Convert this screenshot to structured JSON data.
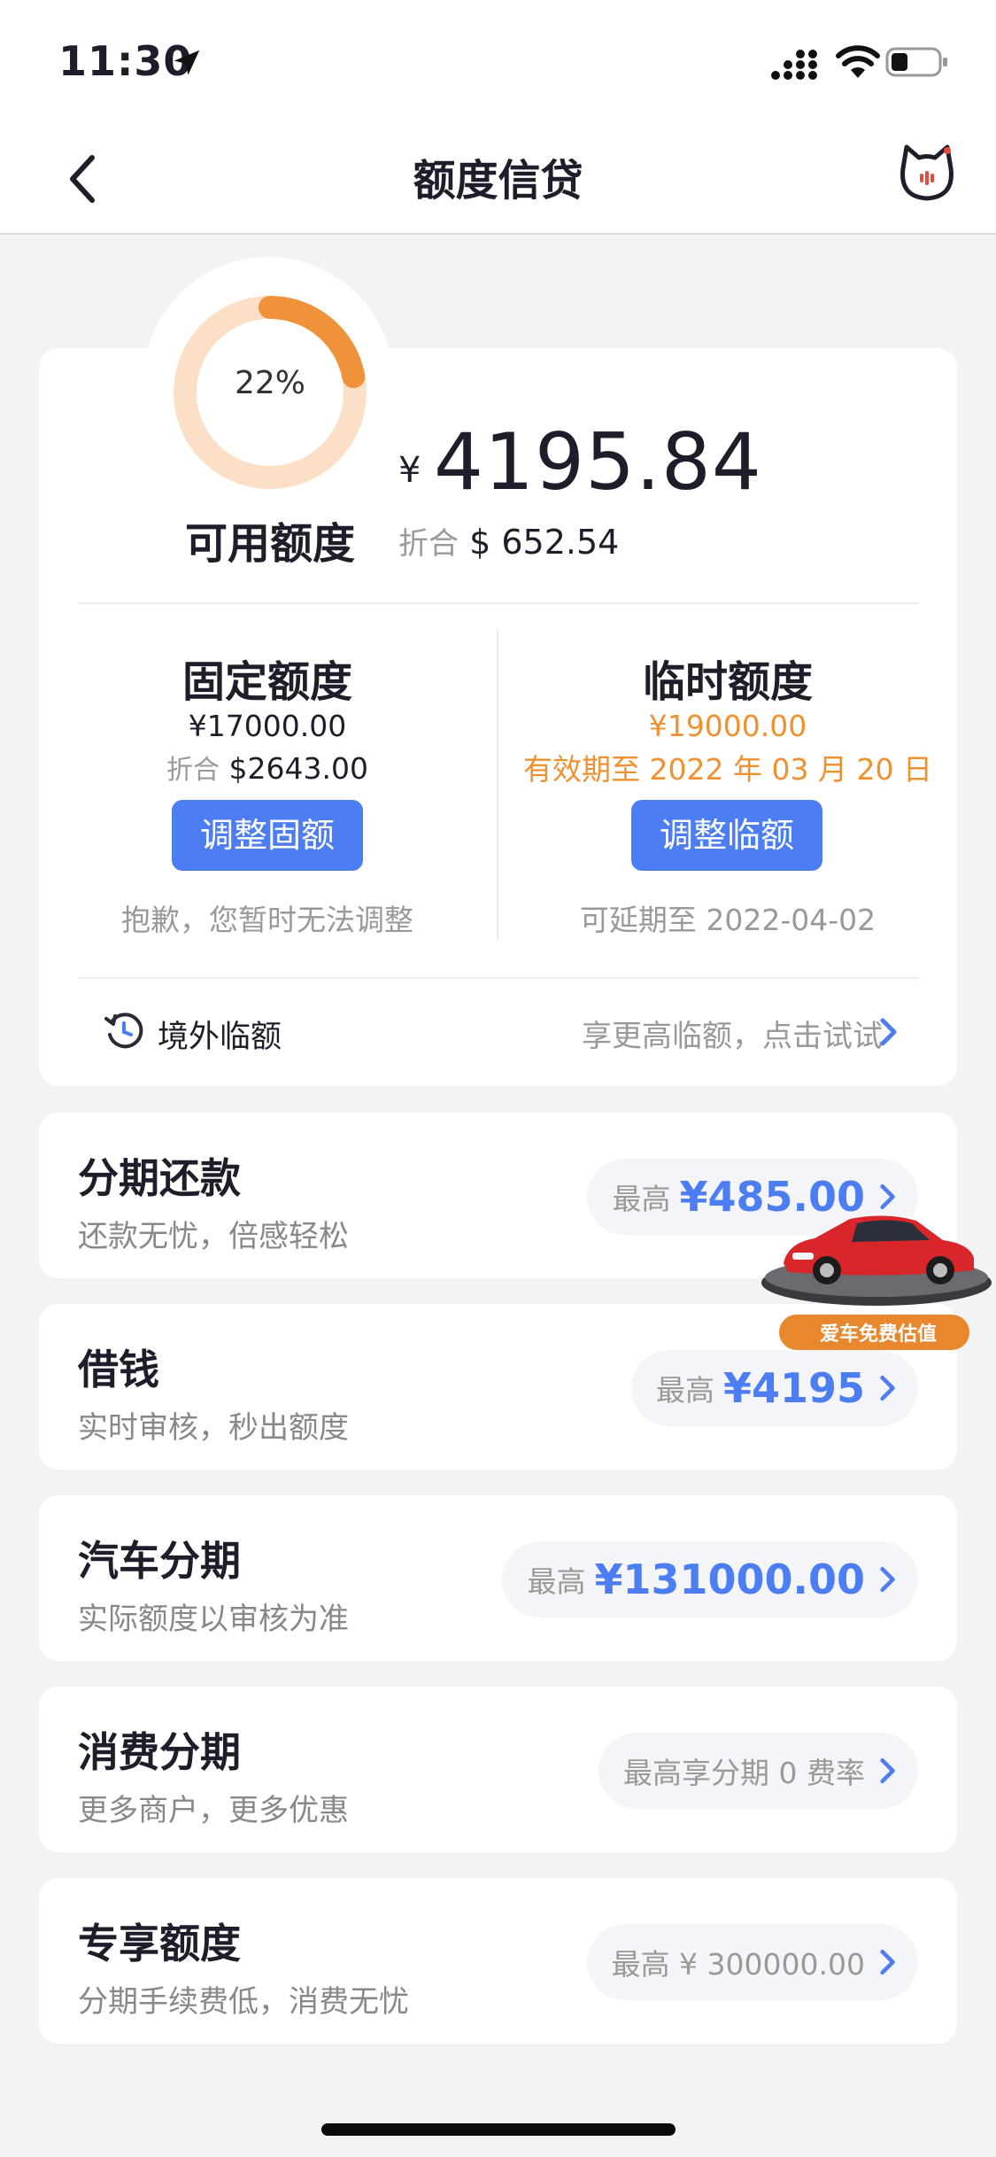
{
  "status_bar": {
    "time": "11:30"
  },
  "nav": {
    "title": "额度信贷"
  },
  "credit": {
    "usage_percent_label": "22%",
    "usage_fraction": 0.22,
    "available_label": "可用额度",
    "currency_symbol": "¥",
    "available_amount": "4195.84",
    "approx_prefix": "折合",
    "approx_value": "$ 652.54"
  },
  "fixed": {
    "title": "固定额度",
    "amount": "¥17000.00",
    "approx_prefix": "折合",
    "approx_value": "$2643.00",
    "button": "调整固额",
    "note": "抱歉，您暂时无法调整"
  },
  "temp": {
    "title": "临时额度",
    "amount": "¥19000.00",
    "validity": "有效期至 2022 年 03 月 20 日",
    "button": "调整临额",
    "note": "可延期至 2022-04-02"
  },
  "overseas": {
    "label": "境外临额",
    "hint": "享更高临额，点击试试"
  },
  "rows": [
    {
      "title": "分期还款",
      "subtitle": "还款无忧，倍感轻松",
      "pre": "最高",
      "value": "¥485.00"
    },
    {
      "title": "借钱",
      "subtitle": "实时审核，秒出额度",
      "pre": "最高",
      "value": "¥4195"
    },
    {
      "title": "汽车分期",
      "subtitle": "实际额度以审核为准",
      "pre": "最高",
      "value": "¥131000.00"
    },
    {
      "title": "消费分期",
      "subtitle": "更多商户，更多优惠",
      "text": "最高享分期 0 费率"
    },
    {
      "title": "专享额度",
      "subtitle": "分期手续费低，消费无忧",
      "text": "最高 ¥ 300000.00"
    }
  ],
  "car_ad": {
    "label": "爱车免费估值"
  },
  "colors": {
    "accent_blue": "#4c7df2",
    "accent_orange": "#f0912f",
    "ring_track": "#fbdfc6"
  }
}
